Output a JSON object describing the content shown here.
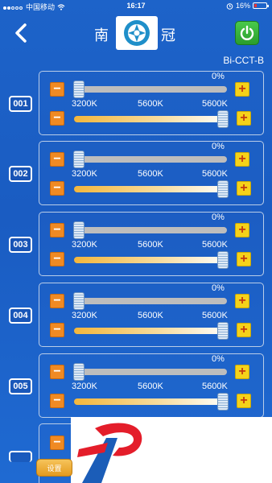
{
  "status_bar": {
    "carrier": "中国移动",
    "time": "16:17",
    "battery": "16%"
  },
  "header": {
    "title_left": "南",
    "title_right": "冠",
    "model": "Bi-CCT-B",
    "icons": {
      "back": "chevron-left-icon",
      "power": "power-icon",
      "logo": "brand-logo"
    }
  },
  "channels": [
    {
      "label": "001",
      "brightness_text": "0%",
      "brightness": 0,
      "cct_labels": [
        "3200K",
        "5600K",
        "5600K"
      ],
      "cct_position": 1
    },
    {
      "label": "002",
      "brightness_text": "0%",
      "brightness": 0,
      "cct_labels": [
        "3200K",
        "5600K",
        "5600K"
      ],
      "cct_position": 1
    },
    {
      "label": "003",
      "brightness_text": "0%",
      "brightness": 0,
      "cct_labels": [
        "3200K",
        "5600K",
        "5600K"
      ],
      "cct_position": 1
    },
    {
      "label": "004",
      "brightness_text": "0%",
      "brightness": 0,
      "cct_labels": [
        "3200K",
        "5600K",
        "5600K"
      ],
      "cct_position": 1
    },
    {
      "label": "005",
      "brightness_text": "0%",
      "brightness": 0,
      "cct_labels": [
        "3200K",
        "5600K",
        "5600K"
      ],
      "cct_position": 1
    }
  ],
  "footer": {
    "settings_label": "设置"
  },
  "colors": {
    "accent_orange": "#f08a23",
    "accent_yellow": "#f5d21a",
    "power_green": "#3bb53d",
    "background_blue": "#1d63c9"
  }
}
